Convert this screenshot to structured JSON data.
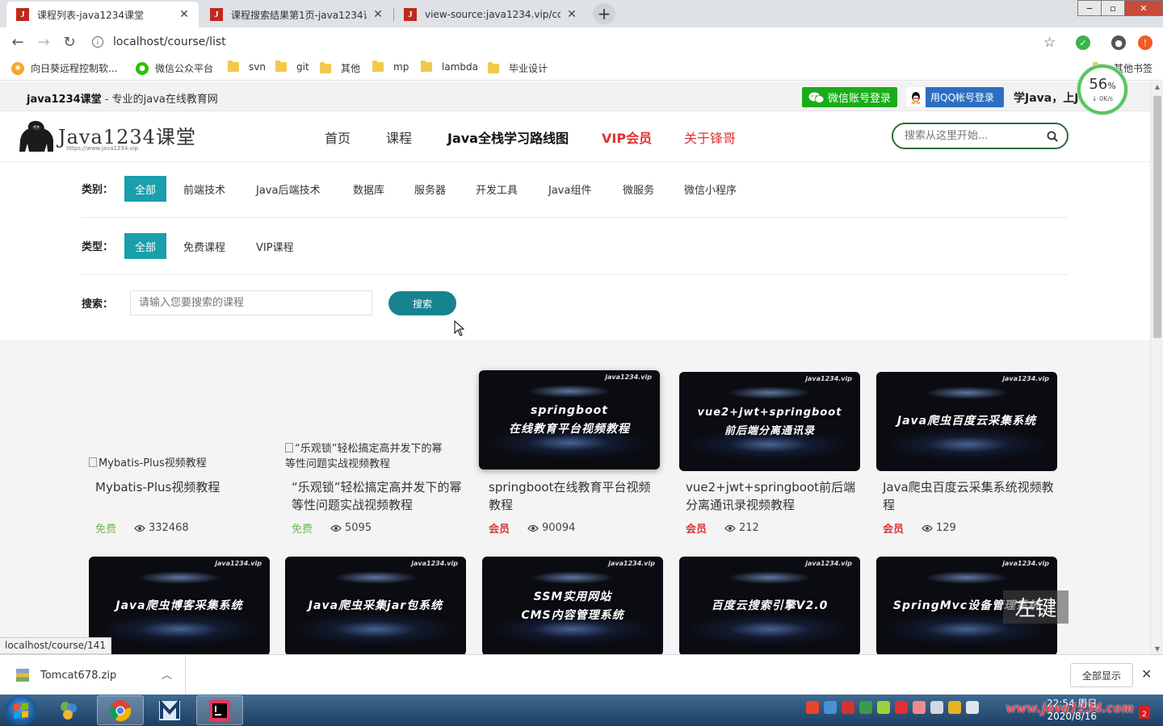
{
  "browser": {
    "tabs": [
      {
        "title": "课程列表-java1234课堂",
        "icon": "J",
        "active": true
      },
      {
        "title": "课程搜索结果第1页-java1234课",
        "icon": "J",
        "active": false
      },
      {
        "title": "view-source:java1234.vip/cou",
        "icon": "J",
        "active": false
      }
    ],
    "new_tab": "+",
    "window_controls": {
      "minimize": "−",
      "maximize": "▫",
      "close": "✕"
    },
    "url": "localhost/course/list",
    "bookmarks": [
      {
        "label": "向日葵远程控制软...",
        "icon": "sunflower-icon"
      },
      {
        "label": "微信公众平台",
        "icon": "wechat-icon"
      },
      {
        "label": "svn",
        "icon": "folder-icon"
      },
      {
        "label": "git",
        "icon": "folder-icon"
      },
      {
        "label": "其他",
        "icon": "folder-icon"
      },
      {
        "label": "mp",
        "icon": "folder-icon"
      },
      {
        "label": "lambda",
        "icon": "folder-icon"
      },
      {
        "label": "毕业设计",
        "icon": "folder-icon"
      },
      {
        "label": "其他书签",
        "icon": "folder-icon"
      }
    ]
  },
  "site": {
    "brand": "java1234课堂",
    "slogan": " - 专业的java在线教育网",
    "login_wechat": "微信账号登录",
    "login_qq": "用QQ帐号登录",
    "learn_text": "学Java，上Java",
    "logo_text": "Java1234课堂",
    "logo_url": "https://www.java1234.vip",
    "nav": [
      "首页",
      "课程",
      "Java全栈学习路线图",
      "VIP会员",
      "关于锋哥"
    ],
    "search_placeholder": "搜索从这里开始..."
  },
  "filters": {
    "category_label": "类别：",
    "categories": [
      "全部",
      "前端技术",
      "Java后端技术",
      "数据库",
      "服务器",
      "开发工具",
      "Java组件",
      "微服务",
      "微信小程序"
    ],
    "type_label": "类型：",
    "types": [
      "全部",
      "免费课程",
      "VIP课程"
    ],
    "search_label": "搜索：",
    "search_placeholder": "请输入您要搜索的课程",
    "search_button": "搜索"
  },
  "courses": [
    {
      "title": "Mybatis-Plus视频教程",
      "broken_alt": "Mybatis-Plus视频教程",
      "tier": "免费",
      "views": "332468"
    },
    {
      "title": "“乐观锁”轻松搞定高并发下的幂等性问题实战视频教程",
      "broken_alt": "“乐观锁”轻松搞定高并发下的幂\n等性问题实战视频教程",
      "tier": "免费",
      "views": "5095"
    },
    {
      "title": "springboot在线教育平台视频教程",
      "thumb_text": "springboot\n在线教育平台视频教程",
      "tier": "会员",
      "views": "90094"
    },
    {
      "title": "vue2+jwt+springboot前后端分离通讯录视频教程",
      "thumb_text": "vue2+jwt+springboot\n前后端分离通讯录",
      "tier": "会员",
      "views": "212"
    },
    {
      "title": "Java爬虫百度云采集系统视频教程",
      "thumb_text": "Java爬虫百度云采集系统",
      "tier": "会员",
      "views": "129"
    },
    {
      "thumb_text": "Java爬虫博客采集系统"
    },
    {
      "thumb_text": "Java爬虫采集jar包系统"
    },
    {
      "thumb_text": "SSM实用网站\nCMS内容管理系统"
    },
    {
      "thumb_text": "百度云搜索引擎V2.0"
    },
    {
      "thumb_text": "SpringMvc设备管理系统"
    }
  ],
  "thumb_watermark": "java1234.vip",
  "status_url": "localhost/course/141",
  "overlay_key": "左键",
  "speed_widget": {
    "percent": "56",
    "unit": "%",
    "rate": "0K/s"
  },
  "download": {
    "file": "Tomcat678.zip",
    "show_all": "全部显示"
  },
  "taskbar": {
    "time": "22:54 周日",
    "date": "2020/8/16",
    "watermark": "www.java1234.com",
    "notif": "2"
  },
  "colors": {
    "accent": "#1a9fac",
    "search_btn": "#17838f",
    "vip": "#dd3333",
    "free": "#6dbb4f",
    "wechat": "#1aad19",
    "qq": "#2b6fc2"
  }
}
